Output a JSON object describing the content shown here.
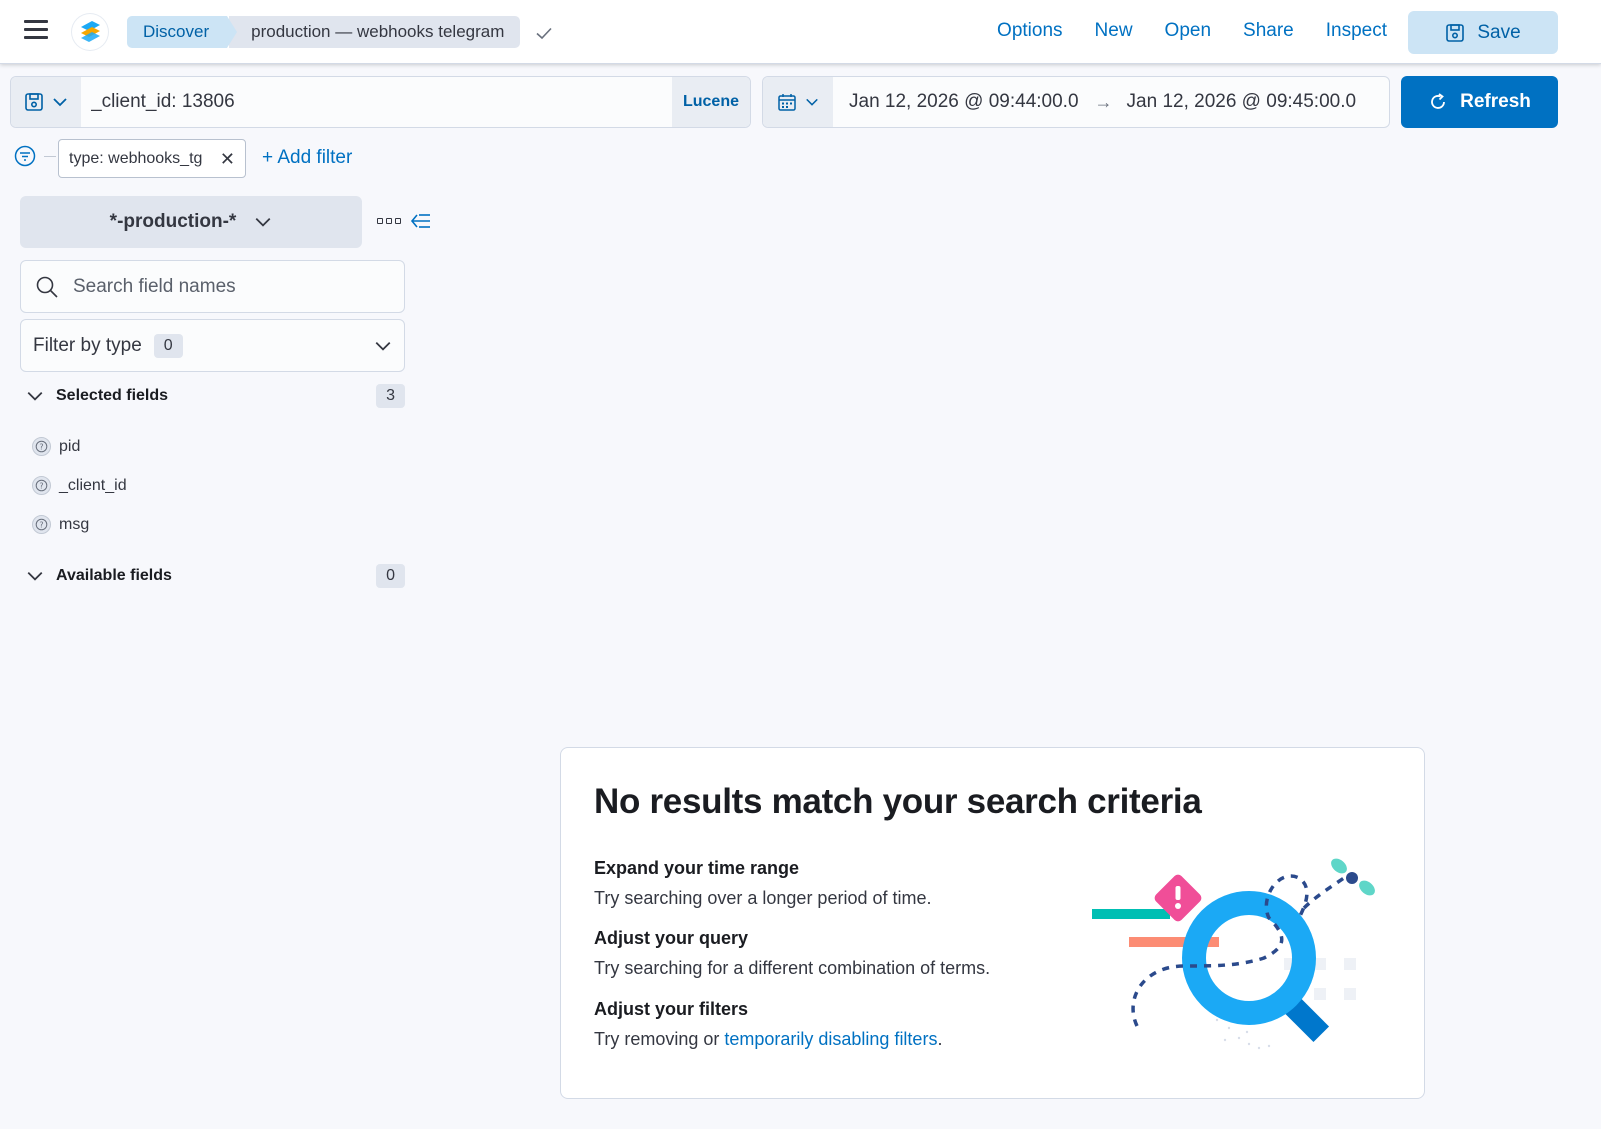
{
  "header": {
    "breadcrumbs": [
      "Discover",
      "production — webhooks telegram"
    ],
    "links": [
      "Options",
      "New",
      "Open",
      "Share",
      "Inspect"
    ],
    "save_label": "Save"
  },
  "query": {
    "value": "_client_id: 13806",
    "language_label": "Lucene"
  },
  "time": {
    "start": "Jan 12, 2026 @ 09:44:00.0",
    "arrow": "→",
    "end": "Jan 12, 2026 @ 09:45:00.0"
  },
  "refresh_label": "Refresh",
  "filters": {
    "pill_label": "type: webhooks_tg",
    "add_label": "+ Add filter"
  },
  "sidebar": {
    "index_pattern": "*-production-*",
    "search_placeholder": "Search field names",
    "filter_by_type_label": "Filter by type",
    "filter_by_type_count": "0",
    "selected_fields_label": "Selected fields",
    "selected_fields_count": "3",
    "selected_fields": [
      "pid",
      "_client_id",
      "msg"
    ],
    "available_fields_label": "Available fields",
    "available_fields_count": "0"
  },
  "empty_state": {
    "title": "No results match your search criteria",
    "tips": [
      {
        "title": "Expand your time range",
        "text": "Try searching over a longer period of time."
      },
      {
        "title": "Adjust your query",
        "text": "Try searching for a different combination of terms."
      },
      {
        "title": "Adjust your filters",
        "text_before": "Try removing or ",
        "link": "temporarily disabling filters",
        "text_after": "."
      }
    ]
  },
  "colors": {
    "primary": "#0071c2",
    "primary_light": "#cce4f5",
    "illustration_blue": "#1ba9f5",
    "illustration_pink": "#f04e98",
    "illustration_teal": "#00bfb3",
    "illustration_salmon": "#fc8c74"
  }
}
